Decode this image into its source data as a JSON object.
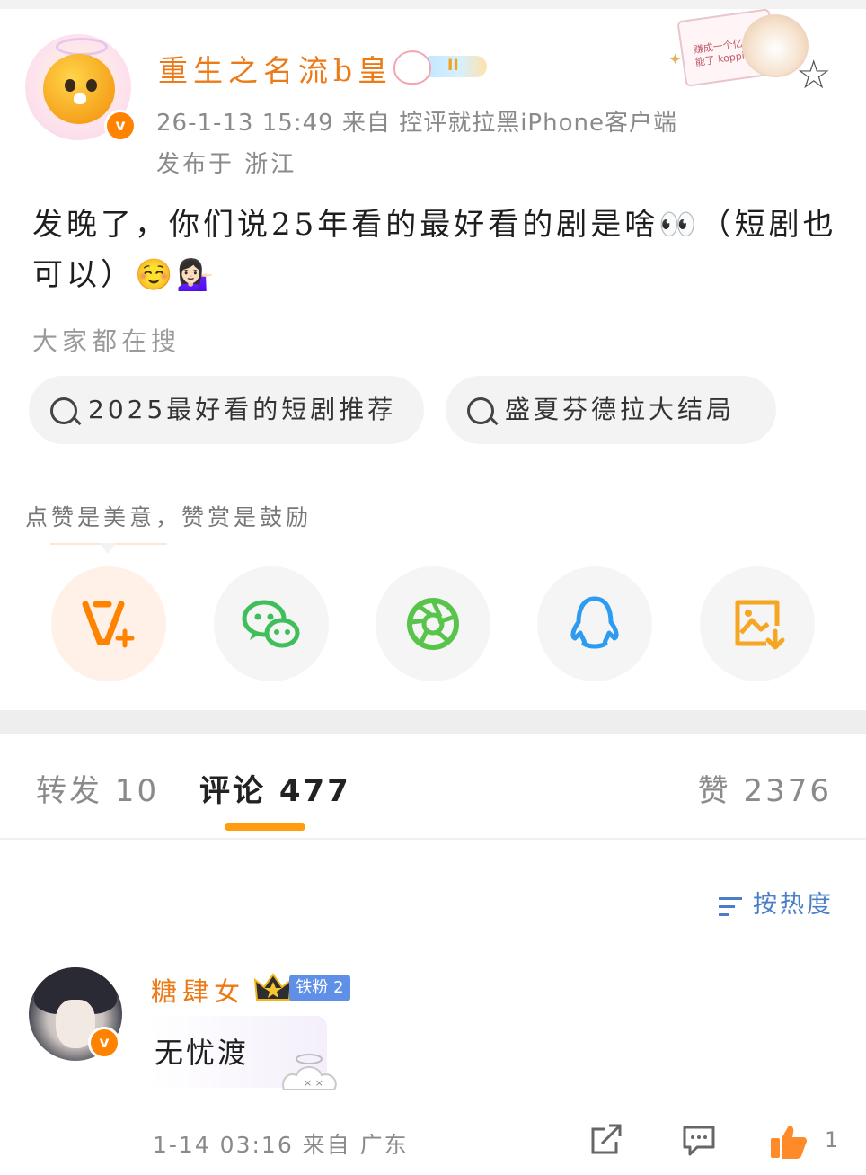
{
  "post": {
    "author": "重生之名流b皇",
    "rank_badge": "II",
    "timestamp_source": "26-1-13 15:49  来自 控评就拉黑iPhone客户端",
    "location": "发布于 浙江",
    "text": "发晚了，你们说25年看的最好看的剧是啥👀（短剧也可以）☺️💁🏻‍♀️",
    "verified_mark": "v",
    "sticker_text": "赚成一个亿 不可能了 kopping"
  },
  "search": {
    "hint": "大家都在搜",
    "chips": [
      {
        "label": "2025最好看的短剧推荐"
      },
      {
        "label": "盛夏芬德拉大结局"
      }
    ]
  },
  "share": {
    "tip": "点赞是美意，赞赏是鼓励",
    "icons": [
      "v-plus-icon",
      "wechat-icon",
      "moments-icon",
      "qq-icon",
      "save-image-icon"
    ],
    "colors": {
      "vplus": "#ff8200",
      "wechat": "#3fbf5a",
      "moments": "#59c44a",
      "qq": "#2d9cf0",
      "save": "#f5a623"
    }
  },
  "tabs": {
    "repost": "转发 10",
    "comments": "评论 477",
    "likes": "赞 2376"
  },
  "sort": {
    "label": "按热度"
  },
  "comment": {
    "author": "糖肆女",
    "fan_badge": "铁粉 2",
    "crown_level": "II",
    "text": "无忧渡",
    "verified_mark": "v",
    "meta": "1-14 03:16  来自 广东",
    "like_count": "1"
  },
  "colors": {
    "accent": "#ff8200",
    "username": "#ec7a16",
    "link": "#4a7fc8",
    "tab_indicator": "#ff9d0e"
  }
}
